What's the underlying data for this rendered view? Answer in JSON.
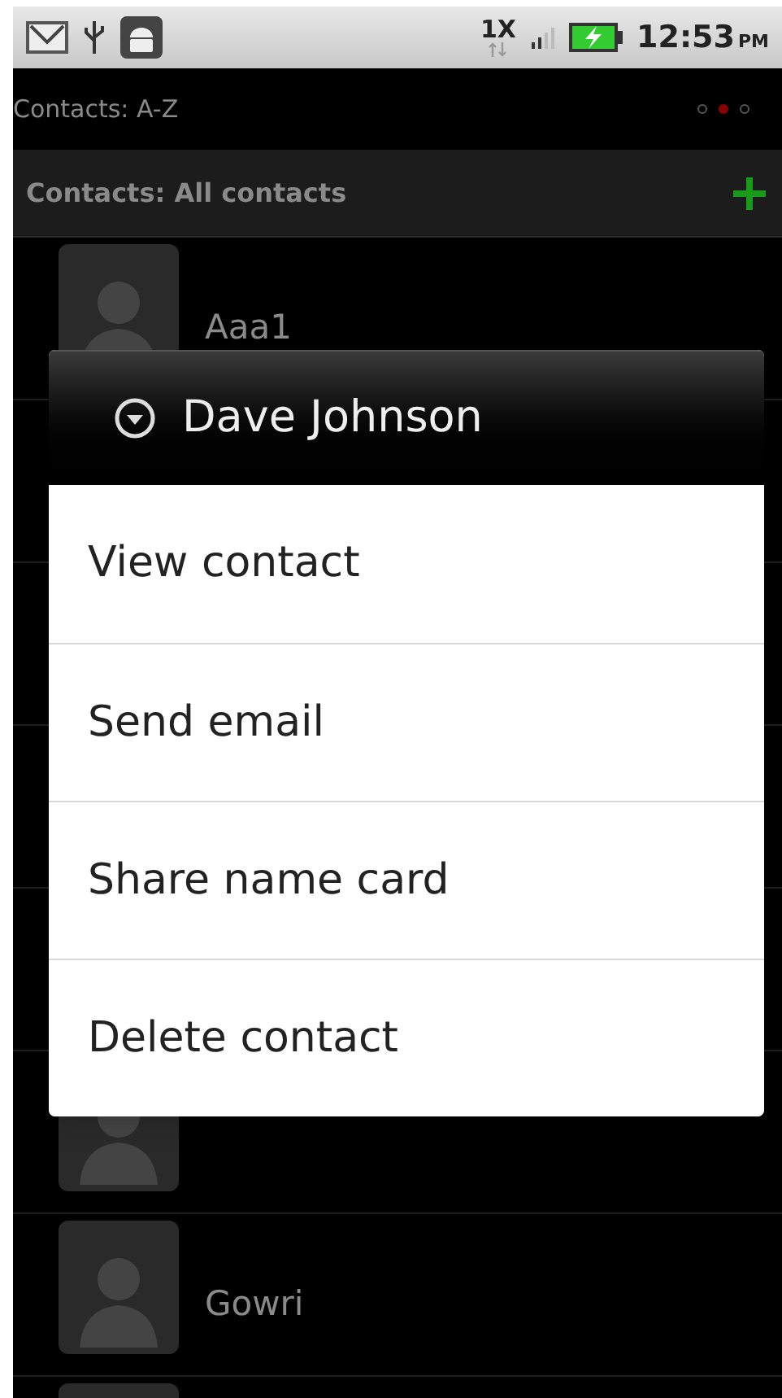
{
  "status_bar": {
    "network": "1X",
    "time": "12:53",
    "ampm": "PM"
  },
  "title_row": {
    "title": "Contacts: A-Z",
    "pages": [
      {
        "selected": false
      },
      {
        "selected": true
      },
      {
        "selected": false
      }
    ]
  },
  "list_header": {
    "title": "Contacts: All contacts"
  },
  "contacts": [
    {
      "kind": "named",
      "name": "Aaa1"
    },
    {
      "kind": "blank"
    },
    {
      "kind": "blank"
    },
    {
      "kind": "blank"
    },
    {
      "kind": "blank"
    },
    {
      "kind": "blank"
    },
    {
      "kind": "named",
      "name": "Gowri"
    },
    {
      "kind": "blank"
    }
  ],
  "dialog": {
    "title": "Dave Johnson",
    "items": [
      "View contact",
      "Send email",
      "Share name card",
      "Delete contact"
    ]
  }
}
